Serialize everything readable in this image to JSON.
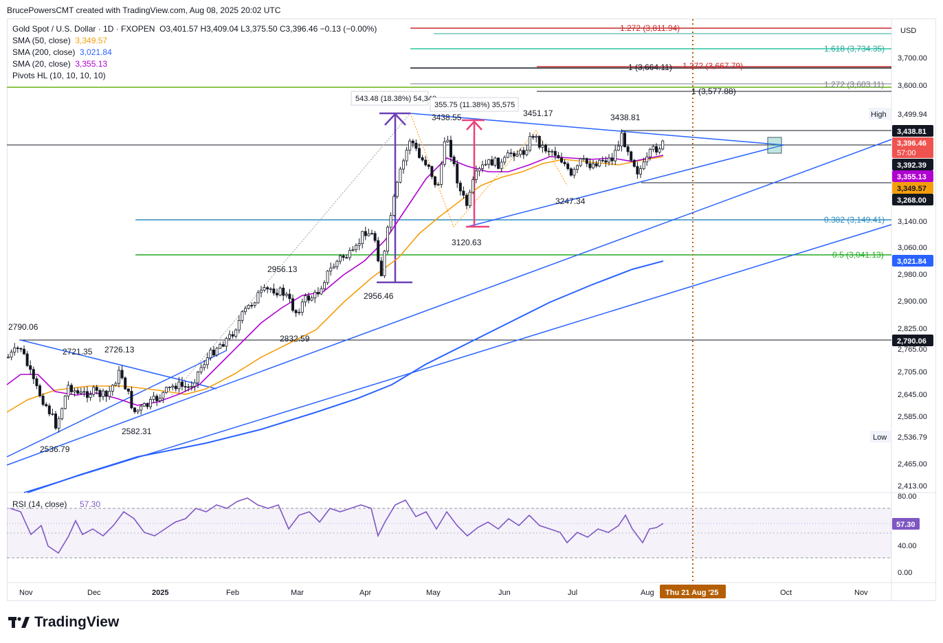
{
  "header": {
    "creator": "BrucePowersCMT created with TradingView.com, Aug 08, 2025 20:02 UTC"
  },
  "legend": {
    "symbol": "Gold Spot / U.S. Dollar · 1D · FXOPEN",
    "ohlc": "O3,401.57  H3,409.04  L3,375.50  C3,396.46  −0.13 (−0.00%)",
    "indicators": [
      {
        "label": "SMA (50, close)",
        "value": "3,349.57",
        "color": "#f59e0b"
      },
      {
        "label": "SMA (200, close)",
        "value": "3,021.84",
        "color": "#2962ff"
      },
      {
        "label": "SMA (20, close)",
        "value": "3,355.13",
        "color": "#b000d0"
      },
      {
        "label": "Pivots HL (10, 10, 10, 10)",
        "value": "",
        "color": "#131722"
      }
    ]
  },
  "brand": {
    "name": "TradingView",
    "logo_icon": "tradingview-logo-icon"
  },
  "chart_data": {
    "type": "candlestick",
    "currency": "USD",
    "x_axis_labels": [
      "Nov",
      "Dec",
      "2025",
      "Feb",
      "Mar",
      "Apr",
      "May",
      "Jun",
      "Jul",
      "Aug",
      "Oct",
      "Nov"
    ],
    "x_cursor_label": "Thu 21 Aug '25",
    "y_axis_ticks": [
      "3,700.00",
      "3,600.00",
      "3,140.00",
      "3,060.00",
      "2,980.00",
      "2,900.00",
      "2,825.00",
      "2,765.00",
      "2,705.00",
      "2,645.00",
      "2,585.00",
      "2,465.00",
      "2,413.00"
    ],
    "price_badges": [
      {
        "text": "3,438.81",
        "bg": "#131722"
      },
      {
        "text": "3,396.46",
        "bg": "#ef5350"
      },
      {
        "text": "57:00",
        "bg": "#ef5350"
      },
      {
        "text": "3,392.39",
        "bg": "#131722"
      },
      {
        "text": "3,355.13",
        "bg": "#b000d0"
      },
      {
        "text": "3,349.57",
        "bg": "#f59e0b"
      },
      {
        "text": "3,268.00",
        "bg": "#131722"
      },
      {
        "text": "3,021.84",
        "bg": "#2962ff"
      },
      {
        "text": "2,790.06",
        "bg": "#131722"
      }
    ],
    "high": {
      "label": "High",
      "value": "3,499.94"
    },
    "low": {
      "label": "Low",
      "value": "2,536.79"
    },
    "fib_labels": [
      {
        "text": "1.272 (3,811.94)",
        "color": "#c62828"
      },
      {
        "text": "1.618 (3,734.35)",
        "color": "#26a69a"
      },
      {
        "text": "1 (3,664.11)",
        "color": "#131722"
      },
      {
        "text": "1.272 (3,667.79)",
        "color": "#c62828"
      },
      {
        "text": "1.272 (3,603.11)",
        "color": "#787b86"
      },
      {
        "text": "1 (3,577.88)",
        "color": "#131722"
      },
      {
        "text": "0.382 (3,149.41)",
        "color": "#2b8cbe"
      },
      {
        "text": "0.5 (3,041.13)",
        "color": "#22aa22"
      }
    ],
    "pivot_labels": [
      "2790.06",
      "2721.35",
      "2726.13",
      "2536.79",
      "2582.31",
      "2956.13",
      "2832.59",
      "2956.46",
      "3438.55",
      "3451.17",
      "3438.81",
      "3247.34",
      "3120.63"
    ],
    "measure_labels": [
      "543.48 (18.38%) 54,348",
      "355.75 (11.38%) 35,575"
    ],
    "rsi": {
      "label": "RSI (14, close)",
      "value": "57.30",
      "ticks": [
        "80.00",
        "40.00",
        "0.00"
      ]
    }
  }
}
